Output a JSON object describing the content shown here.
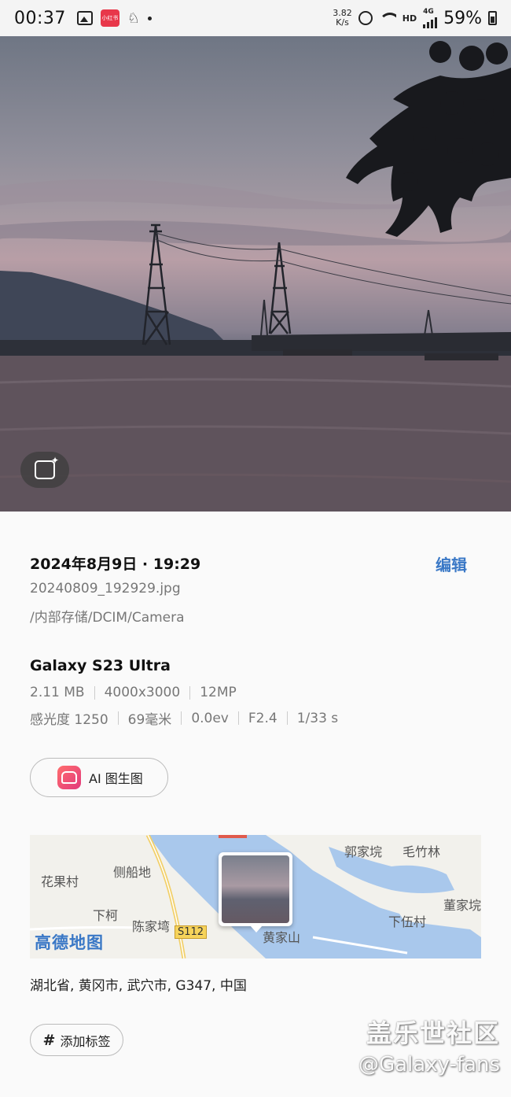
{
  "status_bar": {
    "time": "00:37",
    "app_badge": "小红书",
    "speed_value": "3.82",
    "speed_unit": "K/s",
    "network_hd": "HD",
    "network_type": "4G",
    "battery": "59%"
  },
  "photo": {
    "ai_button_icon": "sparkle-edit-icon"
  },
  "details": {
    "datetime": "2024年8月9日 · 19:29",
    "edit_label": "编辑",
    "filename": "20240809_192929.jpg",
    "path": "/内部存储/DCIM/Camera",
    "device": "Galaxy S23 Ultra",
    "file_info": [
      "2.11 MB",
      "4000x3000",
      "12MP"
    ],
    "exif": [
      "感光度 1250",
      "69毫米",
      "0.0ev",
      "F2.4",
      "1/33 s"
    ],
    "ai_button_label": "AI 图生图",
    "map": {
      "labels": [
        "郭家垸",
        "毛竹林",
        "花果村",
        "侧船地",
        "董家垸",
        "下柯",
        "下伍村",
        "陈家塆",
        "黄家山"
      ],
      "road": "S112",
      "logo": "高德地图"
    },
    "location": "湖北省, 黄冈市, 武穴市, G347, 中国",
    "tag_hash": "#",
    "tag_label": "添加标签"
  },
  "watermark": {
    "line1": "盖乐世社区",
    "line2": "@Galaxy-fans"
  },
  "colors": {
    "accent": "#3a78c6",
    "ai_icon": "#e8374a"
  }
}
